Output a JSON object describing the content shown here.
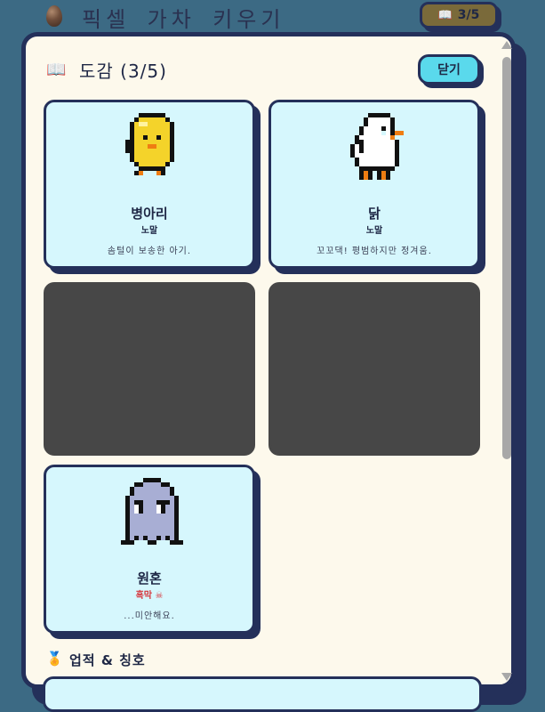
{
  "app": {
    "title": "픽셀 가차 키우기",
    "collection_count": "3/5"
  },
  "dex": {
    "title": "도감 (3/5)",
    "close_label": "닫기",
    "cards": [
      {
        "name": "병아리",
        "rarity": "노말",
        "description": "솜털이 보송한 아기.",
        "locked": false,
        "sprite": "chick"
      },
      {
        "name": "닭",
        "rarity": "노말",
        "description": "꼬꼬댁! 평범하지만 정겨움.",
        "locked": false,
        "sprite": "chicken"
      },
      {
        "locked": true
      },
      {
        "locked": true
      },
      {
        "name": "원혼",
        "rarity": "흑막 ☠",
        "description": "...미안해요.",
        "locked": false,
        "sprite": "ghost"
      }
    ]
  },
  "achievements": {
    "title": "업적 & 칭호"
  },
  "colors": {
    "background": "#3c6a84",
    "panel": "#fdf9ec",
    "outline": "#24305a",
    "card": "#d6f7fd",
    "locked_card": "#474747",
    "accent_button": "#5ad9ec",
    "dark_rarity": "#d6343a"
  }
}
